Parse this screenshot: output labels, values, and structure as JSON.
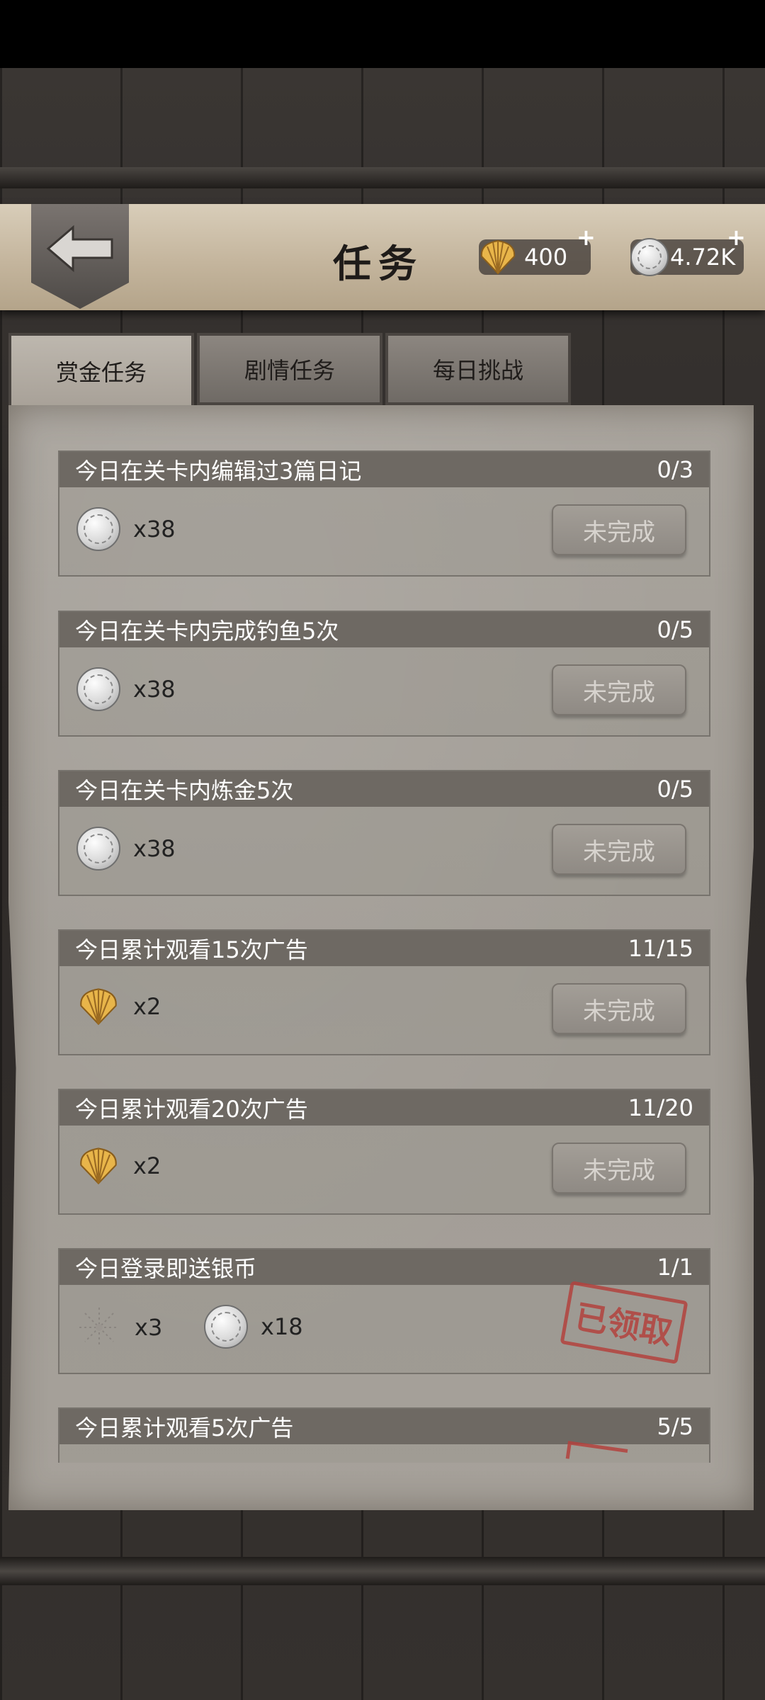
{
  "header": {
    "title": "任务",
    "shells": "400",
    "coins": "4.72K",
    "plus": "+"
  },
  "tabs": [
    {
      "label": "赏金任务",
      "active": true
    },
    {
      "label": "剧情任务",
      "active": false
    },
    {
      "label": "每日挑战",
      "active": false
    }
  ],
  "tasks": [
    {
      "title": "今日在关卡内编辑过3篇日记",
      "progress": "0/3",
      "rewards": [
        {
          "icon": "silver-coin-icon",
          "qty": "x38"
        }
      ],
      "status": "未完成"
    },
    {
      "title": "今日在关卡内完成钓鱼5次",
      "progress": "0/5",
      "rewards": [
        {
          "icon": "silver-coin-icon",
          "qty": "x38"
        }
      ],
      "status": "未完成"
    },
    {
      "title": "今日在关卡内炼金5次",
      "progress": "0/5",
      "rewards": [
        {
          "icon": "silver-coin-icon",
          "qty": "x38"
        }
      ],
      "status": "未完成"
    },
    {
      "title": "今日累计观看15次广告",
      "progress": "11/15",
      "rewards": [
        {
          "icon": "shell-icon",
          "qty": "x2"
        }
      ],
      "status": "未完成"
    },
    {
      "title": "今日累计观看20次广告",
      "progress": "11/20",
      "rewards": [
        {
          "icon": "shell-icon",
          "qty": "x2"
        }
      ],
      "status": "未完成"
    },
    {
      "title": "今日登录即送银币",
      "progress": "1/1",
      "rewards": [
        {
          "icon": "sparkle-icon",
          "qty": "x3"
        },
        {
          "icon": "silver-coin-icon",
          "qty": "x18"
        }
      ],
      "status": "已领取"
    },
    {
      "title": "今日累计观看5次广告",
      "progress": "5/5"
    }
  ],
  "colors": {
    "stamp": "#b3423e",
    "task_header": "#6e6963",
    "paper": "#a6a19a"
  }
}
